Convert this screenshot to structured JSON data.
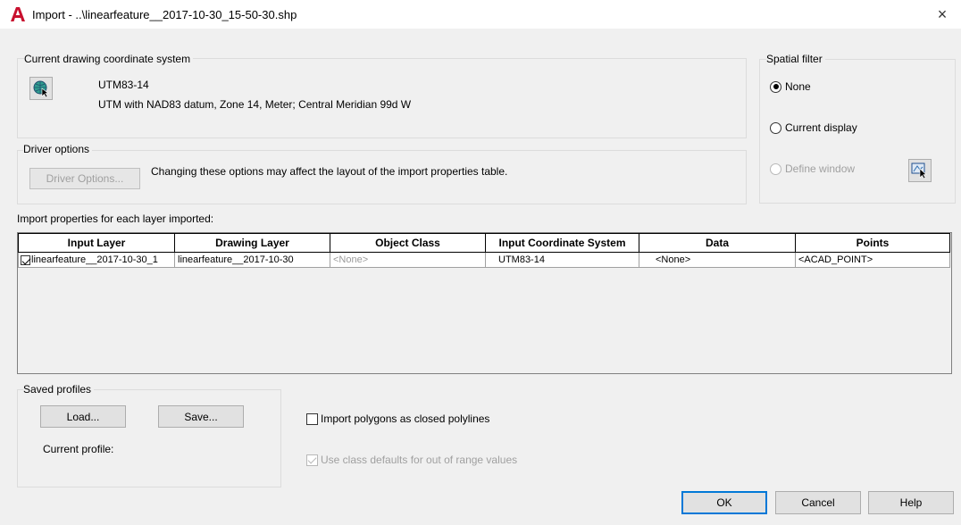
{
  "window": {
    "title": "Import - ..\\linearfeature__2017-10-30_15-50-30.shp",
    "close_symbol": "×"
  },
  "coordinate_system": {
    "group_label": "Current drawing coordinate system",
    "code": "UTM83-14",
    "description": "UTM with NAD83 datum, Zone 14, Meter; Central Meridian 99d W",
    "icon": "globe-cursor-icon"
  },
  "driver_options": {
    "group_label": "Driver options",
    "button_label": "Driver Options...",
    "note": "Changing these options may affect the layout of the import properties table."
  },
  "spatial_filter": {
    "group_label": "Spatial filter",
    "options": [
      {
        "label": "None",
        "checked": true,
        "disabled": false
      },
      {
        "label": "Current display",
        "checked": false,
        "disabled": false
      },
      {
        "label": "Define window",
        "checked": false,
        "disabled": true
      }
    ],
    "pick_icon": "pick-window-icon"
  },
  "import_properties": {
    "label": "Import properties for each layer imported:",
    "columns": [
      "Input Layer",
      "Drawing Layer",
      "Object Class",
      "Input Coordinate System",
      "Data",
      "Points"
    ],
    "rows": [
      {
        "checked": true,
        "input_layer": "linearfeature__2017-10-30_1",
        "drawing_layer": "linearfeature__2017-10-30",
        "object_class": "<None>",
        "coordinate_system": "UTM83-14",
        "data": "<None>",
        "points": "<ACAD_POINT>"
      }
    ]
  },
  "saved_profiles": {
    "group_label": "Saved profiles",
    "load_label": "Load...",
    "save_label": "Save...",
    "current_profile_label": "Current profile:"
  },
  "options": {
    "import_polygons_label": "Import polygons as closed polylines",
    "import_polygons_checked": false,
    "class_defaults_label": "Use class defaults for out of range values",
    "class_defaults_checked": true,
    "class_defaults_disabled": true
  },
  "footer": {
    "ok_label": "OK",
    "cancel_label": "Cancel",
    "help_label": "Help"
  },
  "colors": {
    "autocad_red": "#c8102e",
    "focus_blue": "#0078d7"
  }
}
